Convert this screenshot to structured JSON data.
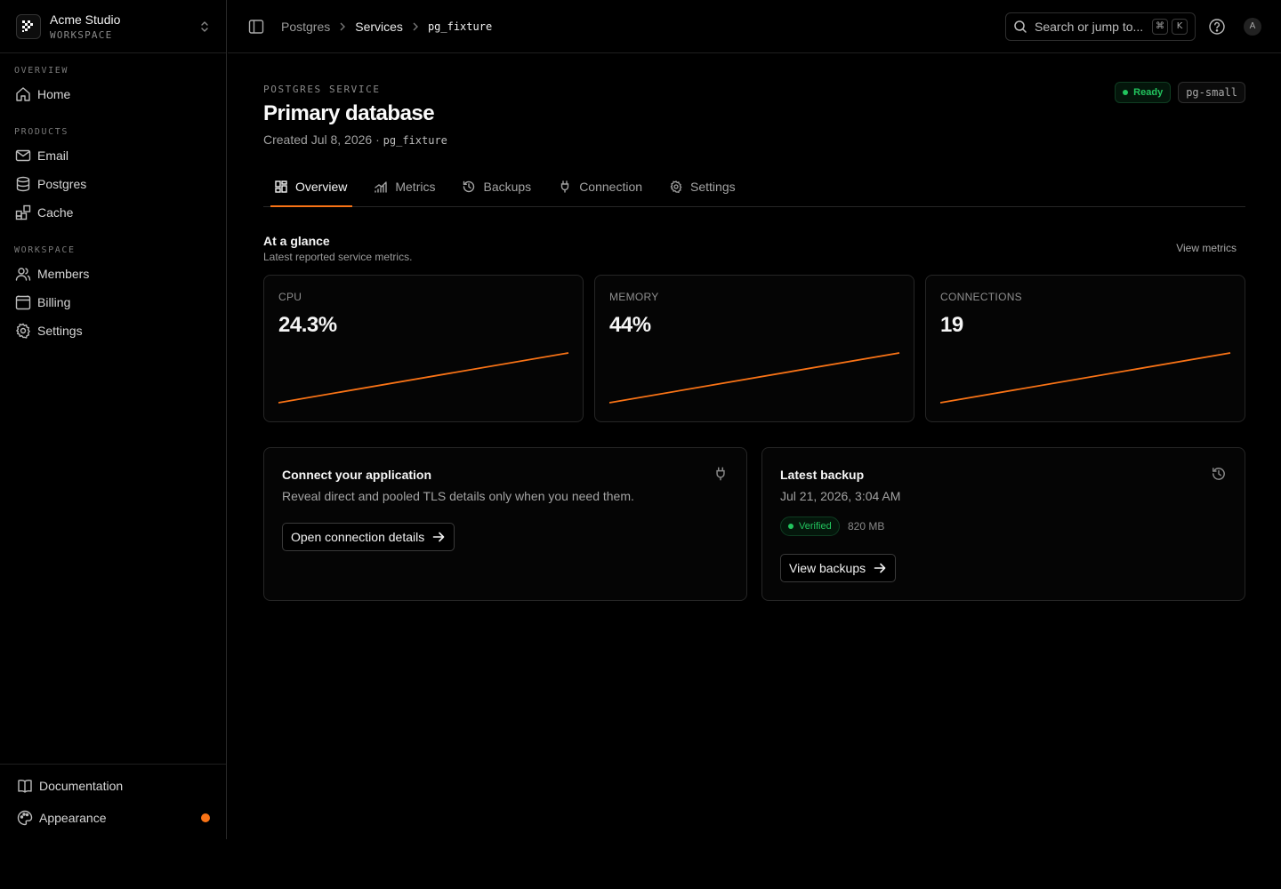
{
  "workspace": {
    "name": "Acme Studio",
    "subtitle": "WORKSPACE"
  },
  "sidebar": {
    "sections": [
      {
        "heading": "OVERVIEW",
        "items": [
          {
            "label": "Home",
            "icon": "home-icon"
          }
        ]
      },
      {
        "heading": "PRODUCTS",
        "items": [
          {
            "label": "Email",
            "icon": "mail-icon"
          },
          {
            "label": "Postgres",
            "icon": "database-icon"
          },
          {
            "label": "Cache",
            "icon": "blocks-icon"
          }
        ]
      },
      {
        "heading": "WORKSPACE",
        "items": [
          {
            "label": "Members",
            "icon": "users-icon"
          },
          {
            "label": "Billing",
            "icon": "billing-icon"
          },
          {
            "label": "Settings",
            "icon": "gear-icon"
          }
        ]
      }
    ],
    "bottom": [
      {
        "label": "Documentation",
        "icon": "book-icon"
      },
      {
        "label": "Appearance",
        "icon": "palette-icon",
        "indicator_color": "#f97316"
      }
    ]
  },
  "breadcrumbs": [
    "Postgres",
    "Services",
    "pg_fixture"
  ],
  "search": {
    "placeholder": "Search or jump to...",
    "shortcut": [
      "⌘",
      "K"
    ]
  },
  "user": {
    "avatar_initial": "A"
  },
  "page": {
    "eyebrow": "POSTGRES SERVICE",
    "title": "Primary database",
    "created": "Created Jul 8, 2026 ·",
    "created_id": "pg_fixture",
    "status": "Ready",
    "status_color": "#22c55e",
    "plan": "pg-small"
  },
  "tabs": [
    {
      "label": "Overview",
      "icon": "grid-icon",
      "active": true
    },
    {
      "label": "Metrics",
      "icon": "chart-icon"
    },
    {
      "label": "Backups",
      "icon": "history-icon"
    },
    {
      "label": "Connection",
      "icon": "plug-icon"
    },
    {
      "label": "Settings",
      "icon": "gear-icon"
    }
  ],
  "glance": {
    "title": "At a glance",
    "subtitle": "Latest reported service metrics.",
    "link": "View metrics",
    "metrics": [
      {
        "label": "CPU",
        "value": "24.3%"
      },
      {
        "label": "MEMORY",
        "value": "44%"
      },
      {
        "label": "CONNECTIONS",
        "value": "19"
      }
    ],
    "accent": "#f97316"
  },
  "connect_card": {
    "title": "Connect your application",
    "subtitle": "Reveal direct and pooled TLS details only when you need them.",
    "button": "Open connection details",
    "icon": "plug-icon"
  },
  "backup_card": {
    "title": "Latest backup",
    "timestamp": "Jul 21, 2026, 3:04 AM",
    "status": "Verified",
    "size": "820 MB",
    "button": "View backups",
    "icon": "history-icon"
  }
}
